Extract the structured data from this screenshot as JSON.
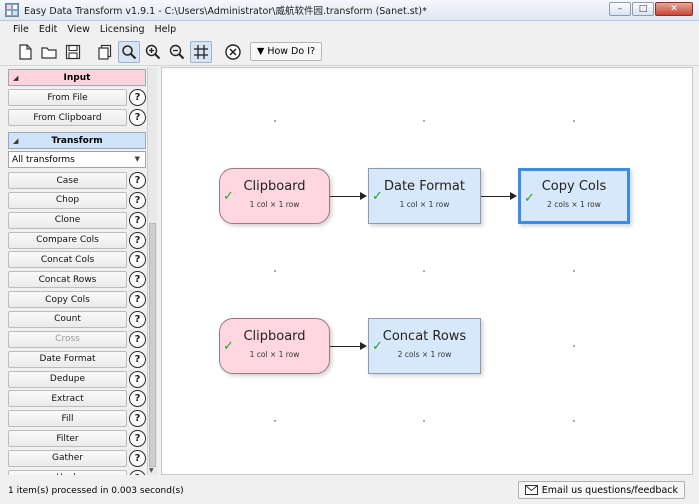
{
  "window": {
    "title": "Easy Data Transform v1.9.1 - C:\\Users\\Administrator\\威航软件园.transform (Sanet.st)*",
    "minimize": "–",
    "maximize": "□",
    "close": "✕"
  },
  "menu": [
    "File",
    "Edit",
    "View",
    "Licensing",
    "Help"
  ],
  "toolbar": {
    "icons": [
      "new-file-icon",
      "open-folder-icon",
      "save-icon",
      "copy-icon",
      "search-icon",
      "zoom-in-icon",
      "zoom-out-icon",
      "grid-icon",
      "close-circle-icon"
    ],
    "how_do_i": "How Do I?"
  },
  "sidebar": {
    "input_header": "Input",
    "input_items": [
      "From File",
      "From Clipboard"
    ],
    "transform_header": "Transform",
    "filter_value": "All transforms",
    "transform_items": [
      "Case",
      "Chop",
      "Clone",
      "Compare Cols",
      "Concat Cols",
      "Concat Rows",
      "Copy Cols",
      "Count",
      "Cross",
      "Date Format",
      "Dedupe",
      "Extract",
      "Fill",
      "Filter",
      "Gather",
      "Hash"
    ],
    "disabled_items": [
      "Cross"
    ],
    "help_glyph": "?"
  },
  "canvas": {
    "nodes": [
      {
        "id": "n1",
        "name": "Clipboard",
        "info": "1 col × 1 row",
        "kind": "input"
      },
      {
        "id": "n2",
        "name": "Date Format",
        "info": "1 col × 1 row",
        "kind": "transform"
      },
      {
        "id": "n3",
        "name": "Copy Cols",
        "info": "2 cols × 1 row",
        "kind": "transform",
        "selected": true
      },
      {
        "id": "n4",
        "name": "Clipboard",
        "info": "1 col × 1 row",
        "kind": "input"
      },
      {
        "id": "n5",
        "name": "Concat Rows",
        "info": "2 cols × 1 row",
        "kind": "transform"
      }
    ],
    "check_glyph": "✓"
  },
  "status": {
    "message": "1 item(s) processed in 0.003 second(s)",
    "email_label": "Email us questions/feedback"
  },
  "colors": {
    "input_node": "#ffd7e1",
    "transform_node": "#d8e8fb",
    "selected_border": "#3a8de0",
    "check": "#2aa02a"
  }
}
